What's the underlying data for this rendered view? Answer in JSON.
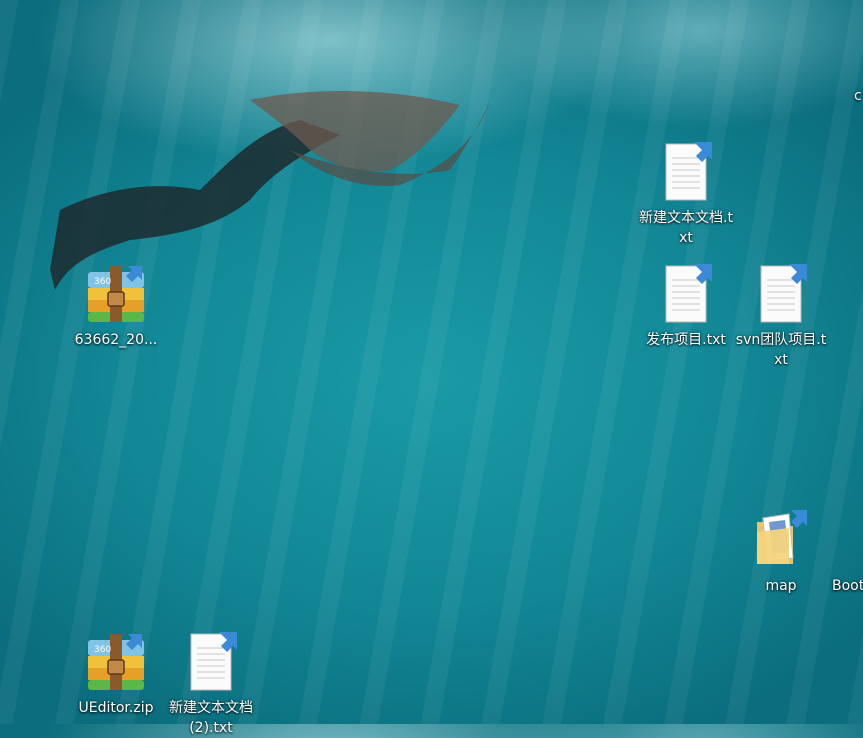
{
  "desktop": {
    "icons": [
      {
        "label": "63662_20...",
        "type": "zip"
      },
      {
        "label": "新建文本文档.txt",
        "type": "txt"
      },
      {
        "label": "发布项目.txt",
        "type": "txt"
      },
      {
        "label": "svn团队项目.txt",
        "type": "txt"
      },
      {
        "label": "map",
        "type": "folder"
      },
      {
        "label": "Boot",
        "type": "partial"
      },
      {
        "label": "UEditor.zip",
        "type": "zip"
      },
      {
        "label": "新建文本文档(2).txt",
        "type": "txt"
      },
      {
        "label": "c",
        "type": "partial-folder"
      }
    ]
  }
}
